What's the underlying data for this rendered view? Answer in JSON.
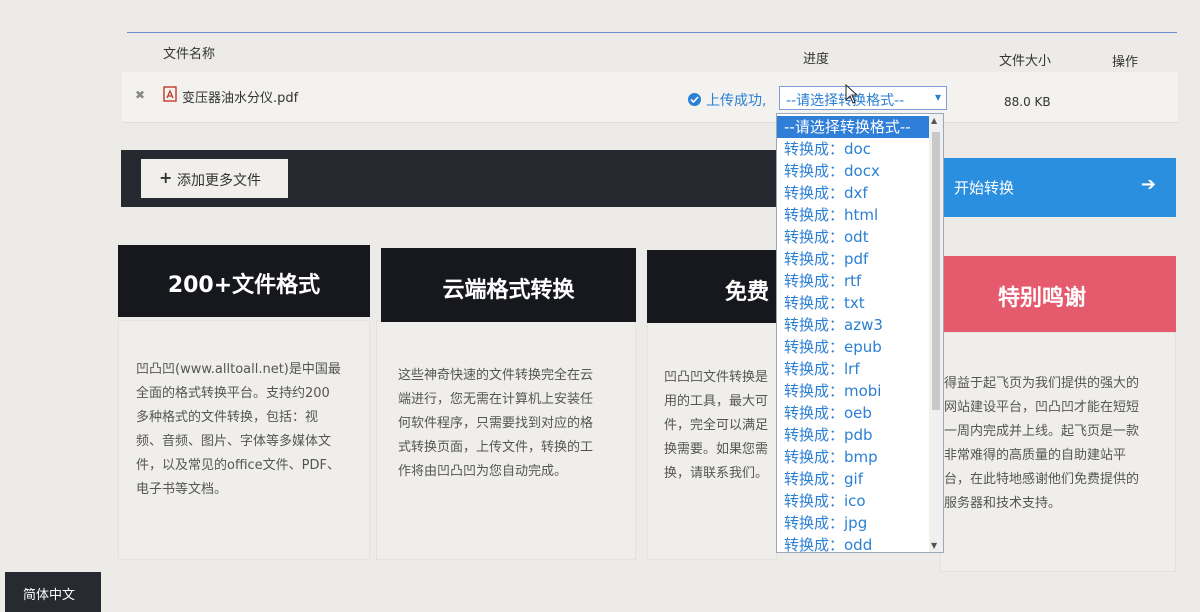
{
  "table": {
    "headers": {
      "name": "文件名称",
      "progress": "进度",
      "size": "文件大小",
      "action": "操作"
    },
    "file": {
      "remove": "✖",
      "name": "变压器油水分仪.pdf",
      "status": "上传成功,",
      "format_selected": "--请选择转换格式--",
      "size": "88.0 KB"
    }
  },
  "toolbar": {
    "add_plus": "+",
    "add_label": "添加更多文件",
    "start_label": "开始转换",
    "start_arrow": "➔"
  },
  "dropdown": {
    "options": [
      "--请选择转换格式--",
      "转换成：doc",
      "转换成：docx",
      "转换成：dxf",
      "转换成：html",
      "转换成：odt",
      "转换成：pdf",
      "转换成：rtf",
      "转换成：txt",
      "转换成：azw3",
      "转换成：epub",
      "转换成：lrf",
      "转换成：mobi",
      "转换成：oeb",
      "转换成：pdb",
      "转换成：bmp",
      "转换成：gif",
      "转换成：ico",
      "转换成：jpg",
      "转换成：odd"
    ],
    "selected_index": 0
  },
  "cards": [
    {
      "title": "200+文件格式",
      "lines": [
        "凹凸凹(www.alltoall.net)是中国最",
        "全面的格式转换平台。支持约200",
        "多种格式的文件转换，包括：视",
        "频、音频、图片、字体等多媒体文",
        "件，以及常见的office文件、PDF、",
        "电子书等文档。"
      ]
    },
    {
      "title": "云端格式转换",
      "lines": [
        "这些神奇快速的文件转换完全在云",
        "端进行，您无需在计算机上安装任",
        "何软件程序，只需要找到对应的格",
        "式转换页面，上传文件，转换的工",
        "作将由凹凸凹为您自动完成。"
      ]
    },
    {
      "title": "免费",
      "lines": [
        "凹凸凹文件转换是",
        "用的工具，最大可",
        "件，完全可以满足",
        "换需要。如果您需",
        "换，请联系我们。"
      ]
    },
    {
      "title": "特别鸣谢",
      "lines": [
        "得益于起飞页为我们提供的强大的",
        "网站建设平台，凹凸凹才能在短短",
        "一周内完成并上线。起飞页是一款",
        "非常难得的高质量的自助建站平",
        "台，在此特地感谢他们免费提供的",
        "服务器和技术支持。"
      ]
    }
  ],
  "footer": {
    "language": "简体中文"
  },
  "icons": {
    "remove": "close-icon",
    "file": "pdf-file-icon",
    "status": "check-circle-icon",
    "add": "plus-icon",
    "start": "arrow-right-icon",
    "cursor": "mouse-pointer-icon"
  },
  "colors": {
    "accent_blue": "#2b7fd4",
    "start_button": "#2b8fe0",
    "toolbar_dark": "#262a30",
    "card_dark": "#17181d",
    "card_pink": "#e55a6c",
    "pdf_red": "#c0392b"
  }
}
